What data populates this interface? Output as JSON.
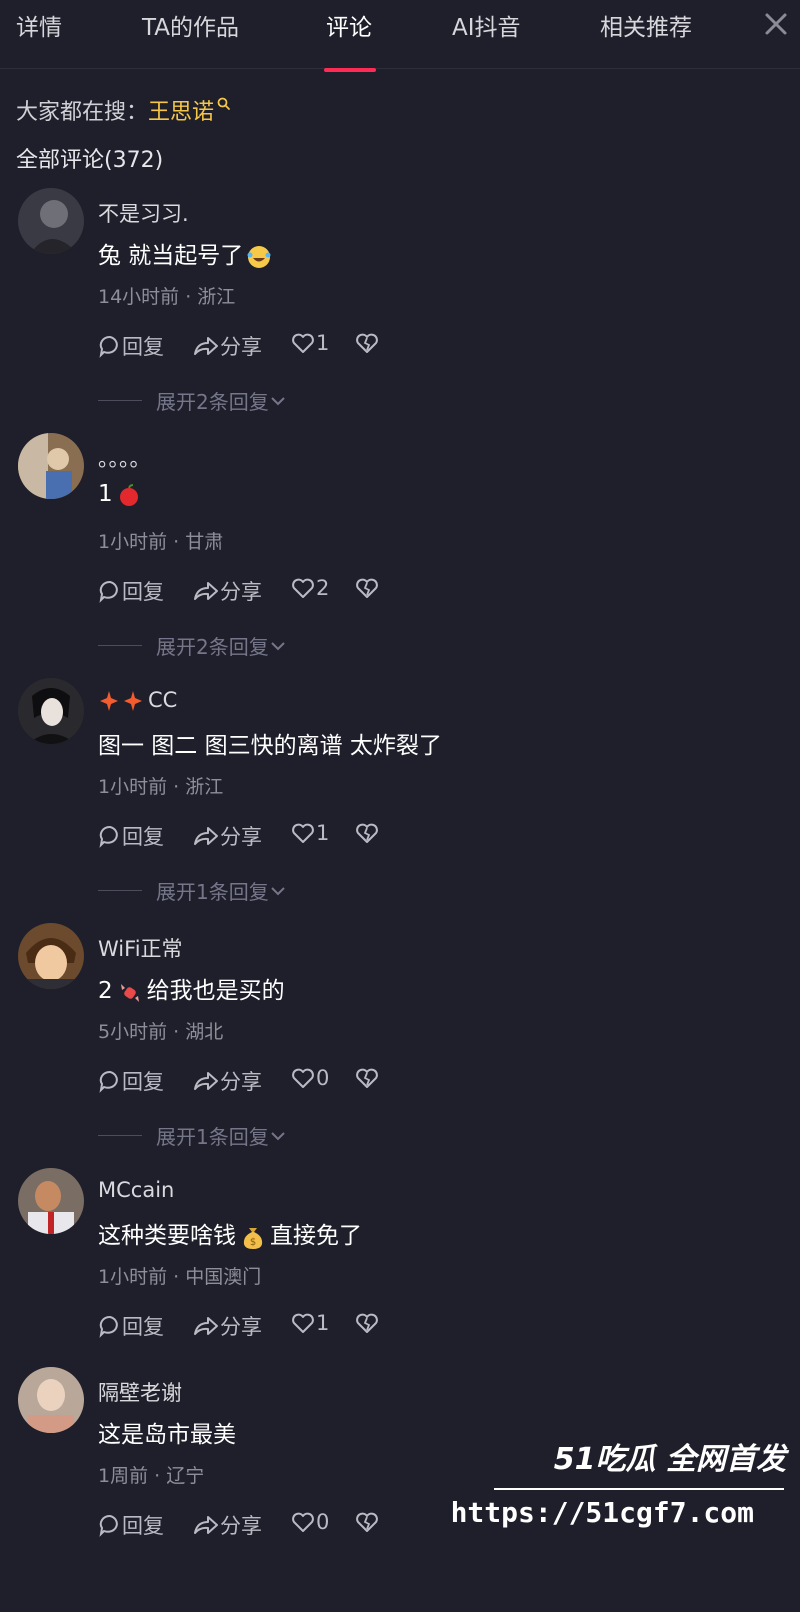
{
  "tabs": [
    {
      "label": "详情"
    },
    {
      "label": "TA的作品"
    },
    {
      "label": "评论"
    },
    {
      "label": "AI抖音"
    },
    {
      "label": "相关推荐"
    }
  ],
  "active_tab": "评论",
  "hot_search": {
    "prefix": "大家都在搜：",
    "keyword": "王思诺"
  },
  "comment_count_label": "全部评论(372)",
  "actions": {
    "reply": "回复",
    "share": "分享"
  },
  "comments": [
    {
      "author": "不是习习.",
      "text": "兔 就当起号了",
      "emoji": "laughing-crying-emoji",
      "meta": "14小时前 · 浙江",
      "likes": "1",
      "expand": "展开2条回复",
      "avatar_color": "#3a3a44"
    },
    {
      "author": "。。。。",
      "text": "1",
      "emoji": "apple-emoji",
      "meta": "1小时前 · 甘肃",
      "likes": "2",
      "expand": "展开2条回复",
      "avatar_color": "#8a6e52"
    },
    {
      "author": "CC",
      "author_emoji": "sparkle-emoji",
      "text": "图一 图二 图三快的离谱 太炸裂了",
      "meta": "1小时前 · 浙江",
      "likes": "1",
      "expand": "展开1条回复",
      "avatar_color": "#2a2a2e"
    },
    {
      "author": "WiFi正常",
      "text": "2",
      "emoji": "candy-emoji",
      "text2": "给我也是买的",
      "meta": "5小时前 · 湖北",
      "likes": "0",
      "expand": "展开1条回复",
      "avatar_color": "#6b4a2e"
    },
    {
      "author": "MCcain",
      "text": "这种类要啥钱",
      "emoji": "money-bag-emoji",
      "text2": "直接免了",
      "meta": "1小时前 · 中国澳门",
      "likes": "1",
      "avatar_color": "#7a6d64"
    },
    {
      "author": "隔壁老谢",
      "text": "这是岛市最美",
      "meta": "1周前 · 辽宁",
      "likes": "0",
      "avatar_color": "#b9a89a"
    }
  ],
  "watermark": {
    "brand": "51吃瓜 全网首发",
    "url": "https://51cgf7.com"
  },
  "colors": {
    "background": "#1e1f2a",
    "accent": "#fe2c55",
    "keyword": "#f5c648"
  }
}
